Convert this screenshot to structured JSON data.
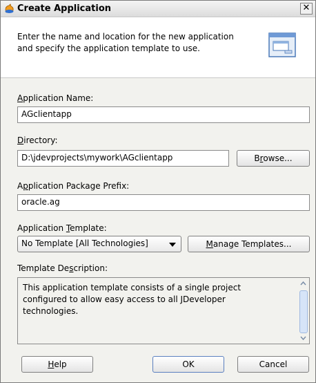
{
  "dialog": {
    "title": "Create Application",
    "close_label": "✕",
    "intro_line1": "Enter the name and location for the new application",
    "intro_line2": "and specify the application template to use."
  },
  "fields": {
    "name_label": "Application Name:",
    "name_value": "AGclientapp",
    "dir_label": "Directory:",
    "dir_value": "D:\\jdevprojects\\mywork\\AGclientapp",
    "browse_label": "Browse...",
    "prefix_label": "Application Package Prefix:",
    "prefix_value": "oracle.ag",
    "template_label": "Application Template:",
    "template_value": "No Template [All Technologies]",
    "manage_label": "Manage Templates...",
    "desc_label": "Template Description:",
    "desc_line1": "This application template consists of a single project",
    "desc_line2": "configured to allow easy access to all JDeveloper",
    "desc_line3": "technologies."
  },
  "buttons": {
    "help": "Help",
    "ok": "OK",
    "cancel": "Cancel"
  },
  "colors": {
    "dialog_bg": "#f2f2ee",
    "header_bg": "#ffffff",
    "scroll_thumb": "#d6e4f8"
  }
}
